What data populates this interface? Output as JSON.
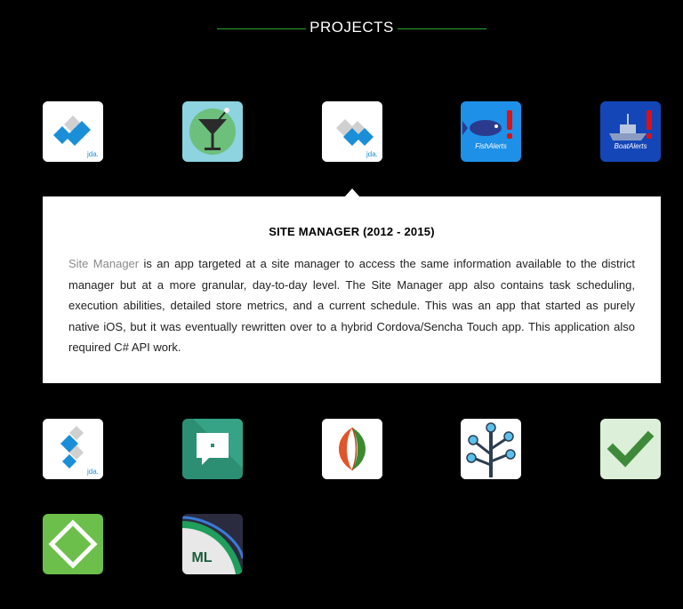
{
  "section": {
    "title": "PROJECTS",
    "accent_color": "#2aa52a"
  },
  "tiles": [
    {
      "name": "jda-app-1",
      "icon": "jda-logo-icon",
      "label": "jda."
    },
    {
      "name": "cocktail-app",
      "icon": "cocktail-glass-icon",
      "label": ""
    },
    {
      "name": "site-manager",
      "icon": "jda-logo-icon",
      "label": "jda.",
      "selected": true
    },
    {
      "name": "fishalerts",
      "icon": "fish-alert-icon",
      "label": "FishAlerts"
    },
    {
      "name": "boatalerts",
      "icon": "boat-alert-icon",
      "label": "BoatAlerts"
    },
    {
      "name": "jda-app-2",
      "icon": "jda-logo-icon",
      "label": "jda."
    },
    {
      "name": "chat-app",
      "icon": "chat-bubble-icon",
      "label": ""
    },
    {
      "name": "leaf-app",
      "icon": "leaf-icon",
      "label": ""
    },
    {
      "name": "tree-app",
      "icon": "tree-nodes-icon",
      "label": ""
    },
    {
      "name": "check-app",
      "icon": "checkmark-icon",
      "label": ""
    },
    {
      "name": "diamond-app",
      "icon": "diamond-icon",
      "label": ""
    },
    {
      "name": "ml-app",
      "icon": "ml-badge-icon",
      "label": "ML"
    }
  ],
  "detail": {
    "title": "SITE MANAGER (2012 - 2015)",
    "link_text": "Site Manager",
    "description": " is an app targeted at a site manager to access the same information available to the district manager but at a more granular, day-to-day level. The Site Manager app also contains task scheduling, execution abilities, detailed store metrics, and a current schedule. This was an app that started as purely native iOS, but it was eventually rewritten over to a hybrid Cordova/Sencha Touch app. This application also required C# API work."
  }
}
